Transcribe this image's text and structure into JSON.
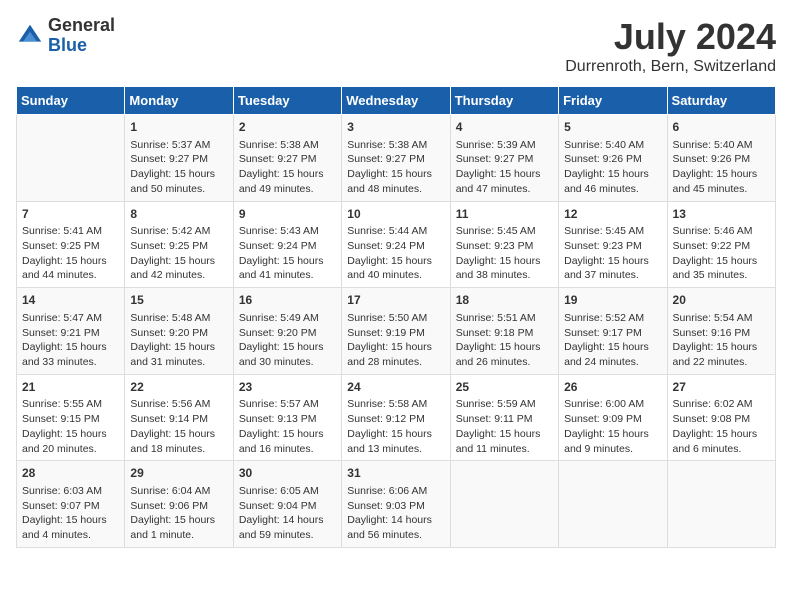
{
  "logo": {
    "general": "General",
    "blue": "Blue"
  },
  "title": "July 2024",
  "subtitle": "Durrenroth, Bern, Switzerland",
  "days_of_week": [
    "Sunday",
    "Monday",
    "Tuesday",
    "Wednesday",
    "Thursday",
    "Friday",
    "Saturday"
  ],
  "weeks": [
    [
      {
        "day": "",
        "content": ""
      },
      {
        "day": "1",
        "content": "Sunrise: 5:37 AM\nSunset: 9:27 PM\nDaylight: 15 hours and 50 minutes."
      },
      {
        "day": "2",
        "content": "Sunrise: 5:38 AM\nSunset: 9:27 PM\nDaylight: 15 hours and 49 minutes."
      },
      {
        "day": "3",
        "content": "Sunrise: 5:38 AM\nSunset: 9:27 PM\nDaylight: 15 hours and 48 minutes."
      },
      {
        "day": "4",
        "content": "Sunrise: 5:39 AM\nSunset: 9:27 PM\nDaylight: 15 hours and 47 minutes."
      },
      {
        "day": "5",
        "content": "Sunrise: 5:40 AM\nSunset: 9:26 PM\nDaylight: 15 hours and 46 minutes."
      },
      {
        "day": "6",
        "content": "Sunrise: 5:40 AM\nSunset: 9:26 PM\nDaylight: 15 hours and 45 minutes."
      }
    ],
    [
      {
        "day": "7",
        "content": "Sunrise: 5:41 AM\nSunset: 9:25 PM\nDaylight: 15 hours and 44 minutes."
      },
      {
        "day": "8",
        "content": "Sunrise: 5:42 AM\nSunset: 9:25 PM\nDaylight: 15 hours and 42 minutes."
      },
      {
        "day": "9",
        "content": "Sunrise: 5:43 AM\nSunset: 9:24 PM\nDaylight: 15 hours and 41 minutes."
      },
      {
        "day": "10",
        "content": "Sunrise: 5:44 AM\nSunset: 9:24 PM\nDaylight: 15 hours and 40 minutes."
      },
      {
        "day": "11",
        "content": "Sunrise: 5:45 AM\nSunset: 9:23 PM\nDaylight: 15 hours and 38 minutes."
      },
      {
        "day": "12",
        "content": "Sunrise: 5:45 AM\nSunset: 9:23 PM\nDaylight: 15 hours and 37 minutes."
      },
      {
        "day": "13",
        "content": "Sunrise: 5:46 AM\nSunset: 9:22 PM\nDaylight: 15 hours and 35 minutes."
      }
    ],
    [
      {
        "day": "14",
        "content": "Sunrise: 5:47 AM\nSunset: 9:21 PM\nDaylight: 15 hours and 33 minutes."
      },
      {
        "day": "15",
        "content": "Sunrise: 5:48 AM\nSunset: 9:20 PM\nDaylight: 15 hours and 31 minutes."
      },
      {
        "day": "16",
        "content": "Sunrise: 5:49 AM\nSunset: 9:20 PM\nDaylight: 15 hours and 30 minutes."
      },
      {
        "day": "17",
        "content": "Sunrise: 5:50 AM\nSunset: 9:19 PM\nDaylight: 15 hours and 28 minutes."
      },
      {
        "day": "18",
        "content": "Sunrise: 5:51 AM\nSunset: 9:18 PM\nDaylight: 15 hours and 26 minutes."
      },
      {
        "day": "19",
        "content": "Sunrise: 5:52 AM\nSunset: 9:17 PM\nDaylight: 15 hours and 24 minutes."
      },
      {
        "day": "20",
        "content": "Sunrise: 5:54 AM\nSunset: 9:16 PM\nDaylight: 15 hours and 22 minutes."
      }
    ],
    [
      {
        "day": "21",
        "content": "Sunrise: 5:55 AM\nSunset: 9:15 PM\nDaylight: 15 hours and 20 minutes."
      },
      {
        "day": "22",
        "content": "Sunrise: 5:56 AM\nSunset: 9:14 PM\nDaylight: 15 hours and 18 minutes."
      },
      {
        "day": "23",
        "content": "Sunrise: 5:57 AM\nSunset: 9:13 PM\nDaylight: 15 hours and 16 minutes."
      },
      {
        "day": "24",
        "content": "Sunrise: 5:58 AM\nSunset: 9:12 PM\nDaylight: 15 hours and 13 minutes."
      },
      {
        "day": "25",
        "content": "Sunrise: 5:59 AM\nSunset: 9:11 PM\nDaylight: 15 hours and 11 minutes."
      },
      {
        "day": "26",
        "content": "Sunrise: 6:00 AM\nSunset: 9:09 PM\nDaylight: 15 hours and 9 minutes."
      },
      {
        "day": "27",
        "content": "Sunrise: 6:02 AM\nSunset: 9:08 PM\nDaylight: 15 hours and 6 minutes."
      }
    ],
    [
      {
        "day": "28",
        "content": "Sunrise: 6:03 AM\nSunset: 9:07 PM\nDaylight: 15 hours and 4 minutes."
      },
      {
        "day": "29",
        "content": "Sunrise: 6:04 AM\nSunset: 9:06 PM\nDaylight: 15 hours and 1 minute."
      },
      {
        "day": "30",
        "content": "Sunrise: 6:05 AM\nSunset: 9:04 PM\nDaylight: 14 hours and 59 minutes."
      },
      {
        "day": "31",
        "content": "Sunrise: 6:06 AM\nSunset: 9:03 PM\nDaylight: 14 hours and 56 minutes."
      },
      {
        "day": "",
        "content": ""
      },
      {
        "day": "",
        "content": ""
      },
      {
        "day": "",
        "content": ""
      }
    ]
  ]
}
